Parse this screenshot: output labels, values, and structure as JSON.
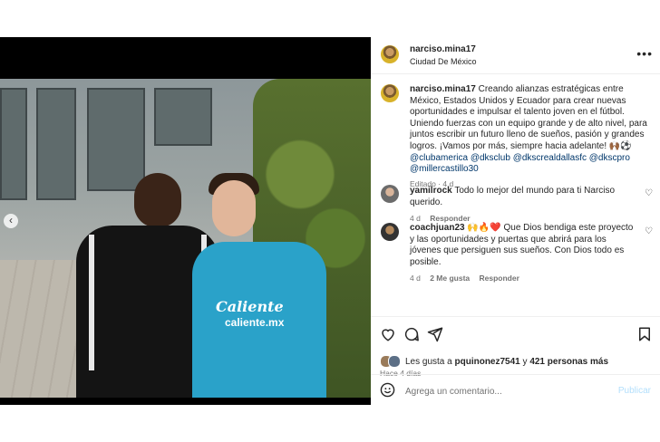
{
  "post": {
    "author": "narciso.mina17",
    "location": "Ciudad De México"
  },
  "caption": {
    "username": "narciso.mina17",
    "text": "Creando alianzas estratégicas entre México, Estados Unidos y Ecuador para crear nuevas oportunidades e impulsar el talento joven en el fútbol. Uniendo fuerzas con un equipo grande y de alto nivel, para juntos escribir un futuro lleno de sueños, pasión y grandes logros. ¡Vamos por más, siempre hacia adelante! 🙌🏾⚽️",
    "mentions": [
      "@clubamerica",
      "@dksclub",
      "@dkscrealdallasfc",
      "@dkscpro",
      "@millercastillo30"
    ],
    "meta": "Editado · 4 d"
  },
  "comments": [
    {
      "username": "yamilrock",
      "text": "Todo lo mejor del mundo para ti Narciso querido.",
      "time": "4 d",
      "reply": "Responder"
    },
    {
      "username": "coachjuan23",
      "text": "🙌🔥❤️ Que Dios bendiga este proyecto y las oportunidades y puertas que abrirá para los jóvenes que persiguen sus sueños. Con Dios todo es posible.",
      "time": "4 d",
      "likes": "2 Me gusta",
      "reply": "Responder"
    }
  ],
  "likes": {
    "prefix": "Les gusta a",
    "user": "pquinonez7541",
    "joiner": "y",
    "others": "421 personas más"
  },
  "posted": "Hace 4 días",
  "comment_box": {
    "placeholder": "Agrega un comentario...",
    "publish": "Publicar"
  },
  "photo": {
    "jersey_brand": "Caliente",
    "jersey_sub": "caliente.mx",
    "slides": 7,
    "active_slide": 6
  },
  "icons": [
    "more-options-icon",
    "heart-icon",
    "comment-icon",
    "share-icon",
    "bookmark-icon",
    "emoji-icon",
    "chevron-left-icon"
  ]
}
